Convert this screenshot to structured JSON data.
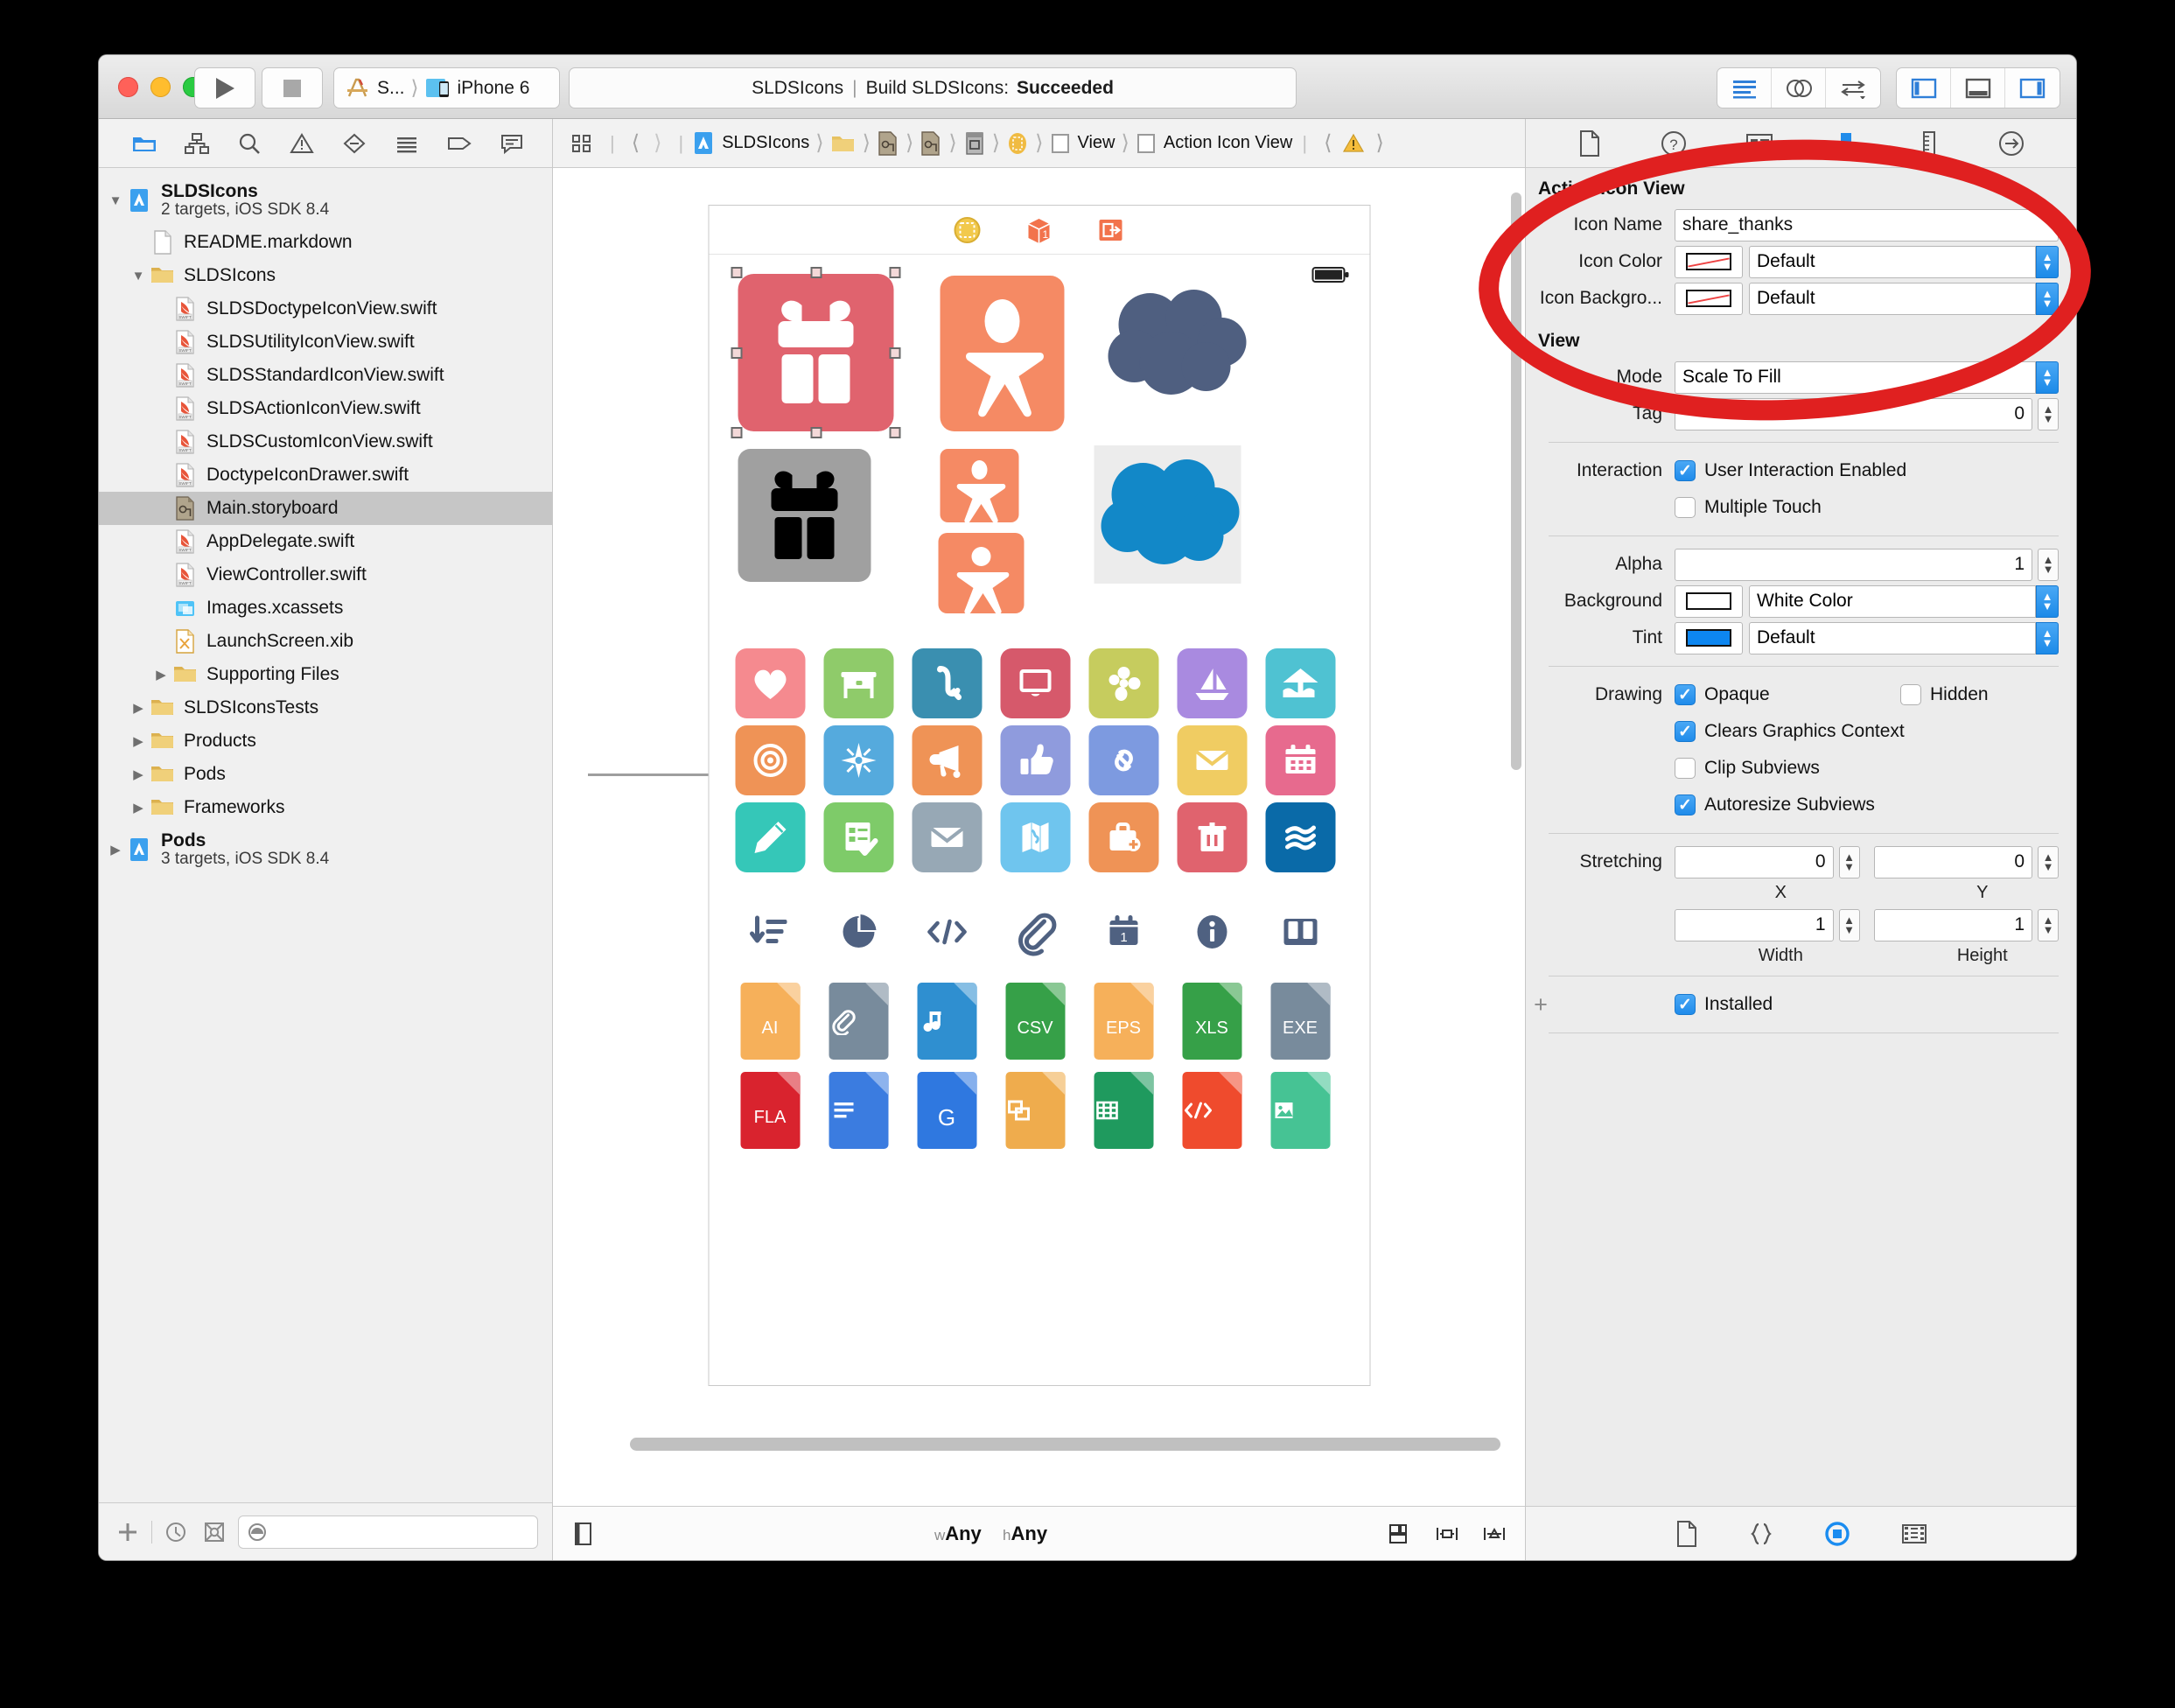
{
  "window": {
    "toolbar": {
      "run_label": "run-button",
      "stop_label": "stop-button",
      "scheme_target": "S...",
      "scheme_device": "iPhone 6",
      "status_project": "SLDSIcons",
      "status_separator": "|",
      "status_action": "Build SLDSIcons:",
      "status_result": "Succeeded"
    }
  },
  "navigator": {
    "toolbar_icons": [
      "folder-icon",
      "hierarchy-icon",
      "search-icon",
      "warning-icon",
      "breakpoint-icon",
      "report-icon",
      "tag-icon",
      "comment-icon"
    ],
    "tree": [
      {
        "indent": 0,
        "twisty": "▼",
        "icon": "xcode-project-icon",
        "title": "SLDSIcons",
        "subtitle": "2 targets, iOS SDK 8.4",
        "bold": true,
        "selected": false
      },
      {
        "indent": 1,
        "twisty": "",
        "icon": "file-plain-icon",
        "title": "README.markdown",
        "subtitle": "",
        "bold": false,
        "selected": false
      },
      {
        "indent": 1,
        "twisty": "▼",
        "icon": "folder-icon",
        "title": "SLDSIcons",
        "subtitle": "",
        "bold": false,
        "selected": false
      },
      {
        "indent": 2,
        "twisty": "",
        "icon": "swift-file-icon",
        "title": "SLDSDoctypeIconView.swift",
        "subtitle": "",
        "bold": false,
        "selected": false
      },
      {
        "indent": 2,
        "twisty": "",
        "icon": "swift-file-icon",
        "title": "SLDSUtilityIconView.swift",
        "subtitle": "",
        "bold": false,
        "selected": false
      },
      {
        "indent": 2,
        "twisty": "",
        "icon": "swift-file-icon",
        "title": "SLDSStandardIconView.swift",
        "subtitle": "",
        "bold": false,
        "selected": false
      },
      {
        "indent": 2,
        "twisty": "",
        "icon": "swift-file-icon",
        "title": "SLDSActionIconView.swift",
        "subtitle": "",
        "bold": false,
        "selected": false
      },
      {
        "indent": 2,
        "twisty": "",
        "icon": "swift-file-icon",
        "title": "SLDSCustomIconView.swift",
        "subtitle": "",
        "bold": false,
        "selected": false
      },
      {
        "indent": 2,
        "twisty": "",
        "icon": "swift-file-icon",
        "title": "DoctypeIconDrawer.swift",
        "subtitle": "",
        "bold": false,
        "selected": false
      },
      {
        "indent": 2,
        "twisty": "",
        "icon": "storyboard-icon",
        "title": "Main.storyboard",
        "subtitle": "",
        "bold": false,
        "selected": true
      },
      {
        "indent": 2,
        "twisty": "",
        "icon": "swift-file-icon",
        "title": "AppDelegate.swift",
        "subtitle": "",
        "bold": false,
        "selected": false
      },
      {
        "indent": 2,
        "twisty": "",
        "icon": "swift-file-icon",
        "title": "ViewController.swift",
        "subtitle": "",
        "bold": false,
        "selected": false
      },
      {
        "indent": 2,
        "twisty": "",
        "icon": "assets-icon",
        "title": "Images.xcassets",
        "subtitle": "",
        "bold": false,
        "selected": false
      },
      {
        "indent": 2,
        "twisty": "",
        "icon": "xib-icon",
        "title": "LaunchScreen.xib",
        "subtitle": "",
        "bold": false,
        "selected": false
      },
      {
        "indent": 2,
        "twisty": "▶",
        "icon": "folder-icon",
        "title": "Supporting Files",
        "subtitle": "",
        "bold": false,
        "selected": false
      },
      {
        "indent": 1,
        "twisty": "▶",
        "icon": "folder-icon",
        "title": "SLDSIconsTests",
        "subtitle": "",
        "bold": false,
        "selected": false
      },
      {
        "indent": 1,
        "twisty": "▶",
        "icon": "folder-icon",
        "title": "Products",
        "subtitle": "",
        "bold": false,
        "selected": false
      },
      {
        "indent": 1,
        "twisty": "▶",
        "icon": "folder-icon",
        "title": "Pods",
        "subtitle": "",
        "bold": false,
        "selected": false
      },
      {
        "indent": 1,
        "twisty": "▶",
        "icon": "folder-icon",
        "title": "Frameworks",
        "subtitle": "",
        "bold": false,
        "selected": false
      },
      {
        "indent": 0,
        "twisty": "▶",
        "icon": "xcode-project-icon",
        "title": "Pods",
        "subtitle": "3 targets, iOS SDK 8.4",
        "bold": true,
        "selected": false
      }
    ],
    "footer": {
      "add_label": "+",
      "recent_icon": "clock-icon",
      "sourcecontrol_icon": "filter-sourcecontrol-icon",
      "filter_placeholder": ""
    }
  },
  "jumpbar": {
    "related_icon": "related-items-icon",
    "back_icon": "chevron-left-icon",
    "forward_icon": "chevron-right-icon",
    "crumbs": [
      {
        "icon": "xcode-project-icon",
        "label": "SLDSIcons"
      },
      {
        "icon": "folder-icon",
        "label": ""
      },
      {
        "icon": "storyboard-icon",
        "label": ""
      },
      {
        "icon": "storyboard-icon",
        "label": ""
      },
      {
        "icon": "scene-icon",
        "label": ""
      },
      {
        "icon": "viewcontroller-icon",
        "label": ""
      },
      {
        "icon": "view-icon",
        "label": "View"
      },
      {
        "icon": "view-icon",
        "label": "Action Icon View"
      }
    ],
    "issue_icon": "warning-triangle-icon"
  },
  "canvas": {
    "scene_dock_icons": [
      "view-controller-dock-icon",
      "first-responder-icon",
      "exit-icon"
    ],
    "selected_tile": "gift-red-tile",
    "big_icons": [
      {
        "name": "gift-pink-tile",
        "bg": "#e0636e",
        "fg": "#ffffff",
        "glyph": "gift-icon",
        "shape": "rounded",
        "selected": true
      },
      {
        "name": "person-orange-tile",
        "bg": "#f58a64",
        "fg": "#ffffff",
        "glyph": "person-icon",
        "shape": "rounded",
        "selected": false
      },
      {
        "name": "cloud-slate-icon",
        "bg": "transparent",
        "fg": "#4f5f80",
        "glyph": "cloud-icon",
        "shape": "none",
        "selected": false
      },
      {
        "name": "gift-gray-tile",
        "bg": "#a0a0a0",
        "fg": "#000000",
        "glyph": "gift-icon",
        "shape": "rounded",
        "selected": false
      },
      {
        "name": "person-small-a",
        "bg": "#f58a64",
        "fg": "#ffffff",
        "glyph": "person-icon",
        "shape": "rounded",
        "selected": false
      },
      {
        "name": "person-small-b",
        "bg": "#f58a64",
        "fg": "#ffffff",
        "glyph": "person-icon",
        "shape": "rounded",
        "selected": false
      },
      {
        "name": "cloud-blue-icon",
        "bg": "#ececec",
        "fg": "#1288c8",
        "glyph": "cloud-icon",
        "shape": "square",
        "selected": false
      }
    ],
    "action_grid": [
      [
        {
          "glyph": "heart-icon",
          "bg": "#f58a8f"
        },
        {
          "glyph": "table-icon",
          "bg": "#8fcb6a"
        },
        {
          "glyph": "sax-icon",
          "bg": "#3a8fb0"
        },
        {
          "glyph": "display-icon",
          "bg": "#d6596b"
        },
        {
          "glyph": "clover-icon",
          "bg": "#c6cc5e"
        },
        {
          "glyph": "sailboat-icon",
          "bg": "#a98ae0"
        },
        {
          "glyph": "beach-icon",
          "bg": "#4fc2d2"
        }
      ],
      [
        {
          "glyph": "target-icon",
          "bg": "#ef9356"
        },
        {
          "glyph": "compass-icon",
          "bg": "#55aadd"
        },
        {
          "glyph": "announce-icon",
          "bg": "#ef9356"
        },
        {
          "glyph": "thumbsup-icon",
          "bg": "#8f9bdd"
        },
        {
          "glyph": "link-icon",
          "bg": "#7d9ae0"
        },
        {
          "glyph": "email-icon",
          "bg": "#f0cc62"
        },
        {
          "glyph": "calendar-icon",
          "bg": "#e76a8e"
        }
      ],
      [
        {
          "glyph": "pencil-icon",
          "bg": "#35c7b8"
        },
        {
          "glyph": "task-icon",
          "bg": "#7ecb69"
        },
        {
          "glyph": "envelope-icon",
          "bg": "#97a8b5"
        },
        {
          "glyph": "map-icon",
          "bg": "#6fc5ee"
        },
        {
          "glyph": "case-add-icon",
          "bg": "#ef9356"
        },
        {
          "glyph": "trash-icon",
          "bg": "#e0636e"
        },
        {
          "glyph": "waves-icon",
          "bg": "#0a6aa8"
        }
      ]
    ],
    "utility_row": [
      {
        "glyph": "sort-desc-icon"
      },
      {
        "glyph": "pie-chart-icon"
      },
      {
        "glyph": "code-icon"
      },
      {
        "glyph": "paperclip-icon"
      },
      {
        "glyph": "date-icon"
      },
      {
        "glyph": "info-icon"
      },
      {
        "glyph": "book-icon"
      }
    ],
    "doctype_grid": [
      [
        {
          "label": "AI",
          "glyph": "",
          "bg": "#f6b05a"
        },
        {
          "label": "",
          "glyph": "paperclip",
          "bg": "#788b9c"
        },
        {
          "label": "",
          "glyph": "music",
          "bg": "#2f8fd0"
        },
        {
          "label": "CSV",
          "glyph": "",
          "bg": "#36a048"
        },
        {
          "label": "EPS",
          "glyph": "",
          "bg": "#f6b05a"
        },
        {
          "label": "XLS",
          "glyph": "",
          "bg": "#36a048"
        },
        {
          "label": "EXE",
          "glyph": "",
          "bg": "#788b9c"
        }
      ],
      [
        {
          "label": "FLA",
          "glyph": "",
          "bg": "#d9232e"
        },
        {
          "label": "",
          "glyph": "lines",
          "bg": "#3b7ce0"
        },
        {
          "label": "G",
          "glyph": "",
          "bg": "#2f78e0"
        },
        {
          "label": "",
          "glyph": "stack",
          "bg": "#efac4d"
        },
        {
          "label": "",
          "glyph": "grid",
          "bg": "#1f9a5e"
        },
        {
          "label": "",
          "glyph": "code",
          "bg": "#ef4b2d"
        },
        {
          "label": "",
          "glyph": "image",
          "bg": "#46c394"
        }
      ]
    ]
  },
  "editor_footer": {
    "left_icon": "document-outline-icon",
    "size_w_prefix": "w",
    "size_w_value": "Any",
    "size_h_prefix": "h",
    "size_h_value": "Any",
    "right_icons": [
      "stack-view-icon",
      "align-icon",
      "resolve-constraints-icon"
    ]
  },
  "inspector": {
    "toolbar_icons": [
      "file-inspector-icon",
      "quick-help-icon",
      "identity-inspector-icon",
      "attributes-inspector-icon",
      "size-inspector-icon",
      "connections-inspector-icon"
    ],
    "selected_tab": "attributes-inspector-icon",
    "sections": {
      "action_icon_view": {
        "title": "Action Icon View",
        "icon_name_label": "Icon Name",
        "icon_name_value": "share_thanks",
        "icon_color_label": "Icon Color",
        "icon_color_value": "Default",
        "icon_background_label": "Icon Backgro...",
        "icon_background_value": "Default"
      },
      "view": {
        "title": "View",
        "mode_label": "Mode",
        "mode_value": "Scale To Fill",
        "tag_label": "Tag",
        "tag_value": "0",
        "interaction_label": "Interaction",
        "user_interaction_label": "User Interaction Enabled",
        "user_interaction_checked": true,
        "multiple_touch_label": "Multiple Touch",
        "multiple_touch_checked": false,
        "alpha_label": "Alpha",
        "alpha_value": "1",
        "background_label": "Background",
        "background_value": "White Color",
        "tint_label": "Tint",
        "tint_value": "Default",
        "drawing_label": "Drawing",
        "opaque_label": "Opaque",
        "opaque_checked": true,
        "hidden_label": "Hidden",
        "hidden_checked": false,
        "clears_graphics_label": "Clears Graphics Context",
        "clears_graphics_checked": true,
        "clip_subviews_label": "Clip Subviews",
        "clip_subviews_checked": false,
        "autoresize_label": "Autoresize Subviews",
        "autoresize_checked": true,
        "stretching_label": "Stretching",
        "stretch_x_value": "0",
        "stretch_y_value": "0",
        "stretch_x_caption": "X",
        "stretch_y_caption": "Y",
        "stretch_w_value": "1",
        "stretch_h_value": "1",
        "stretch_w_caption": "Width",
        "stretch_h_caption": "Height",
        "installed_label": "Installed",
        "installed_checked": true,
        "add_variation_label": "+"
      }
    },
    "footer_icons": [
      "file-template-icon",
      "code-snippet-icon",
      "object-library-icon",
      "media-library-icon"
    ],
    "selected_footer_icon": "object-library-icon"
  },
  "annotation": {
    "shape": "red-ellipse-highlight",
    "color": "#e02020"
  },
  "colors": {
    "accent_blue": "#1f8bea",
    "annotation_red": "#e02020",
    "window_chrome": "#ececec"
  }
}
